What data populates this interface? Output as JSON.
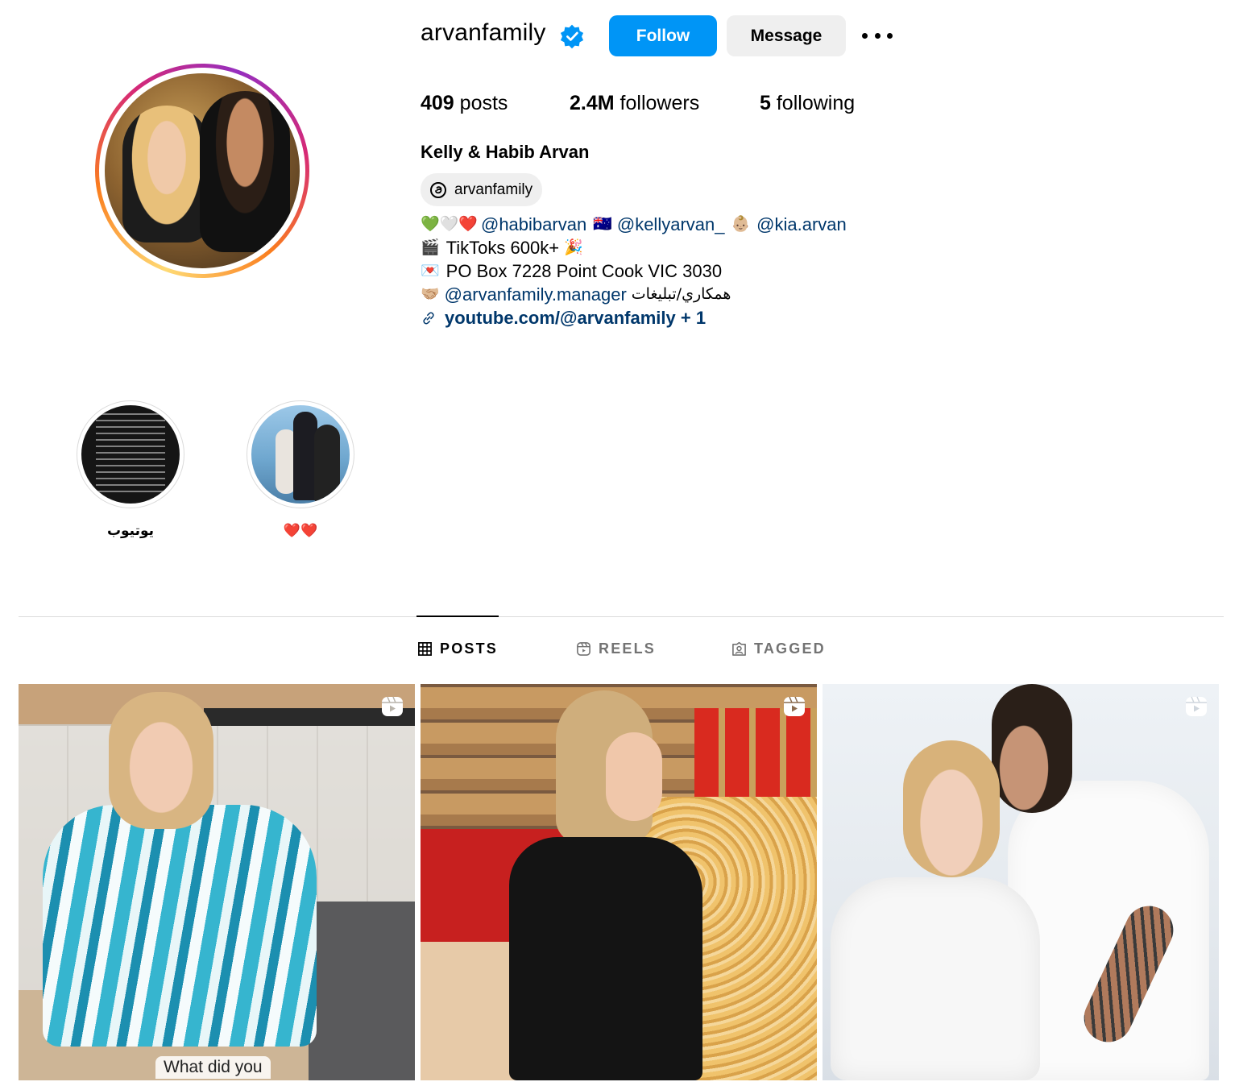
{
  "profile": {
    "username": "arvanfamily",
    "follow_label": "Follow",
    "message_label": "Message",
    "stats": {
      "posts_count": "409",
      "posts_label": "posts",
      "followers_count": "2.4M",
      "followers_label": "followers",
      "following_count": "5",
      "following_label": "following"
    },
    "full_name": "Kelly & Habib Arvan",
    "threads_handle": "arvanfamily",
    "bio": {
      "line1_emoji": "💚🤍❤️",
      "line1_mention1": "@habibarvan",
      "line1_flag": "🇦🇺",
      "line1_mention2": "@kellyarvan_",
      "line1_baby": "👶🏼",
      "line1_mention3": "@kia.arvan",
      "line2_emoji": "🎬",
      "line2_text": "TikToks 600k+",
      "line2_emoji_end": "🎉",
      "line3_emoji": "💌",
      "line3_text": "PO Box 7228 Point Cook VIC 3030",
      "line4_emoji": "🤝🏼",
      "line4_mention": "@arvanfamily.manager",
      "line4_text": "همكاري/تبليغات",
      "link_text": "youtube.com/@arvanfamily + 1"
    }
  },
  "highlights": [
    {
      "label": "يوتيوب"
    },
    {
      "label": "❤️❤️"
    }
  ],
  "tabs": [
    {
      "label": "POSTS",
      "icon": "grid-icon",
      "active": true
    },
    {
      "label": "REELS",
      "icon": "reels-icon",
      "active": false
    },
    {
      "label": "TAGGED",
      "icon": "tagged-icon",
      "active": false
    }
  ],
  "posts": [
    {
      "type": "reel",
      "caption": "What did you"
    },
    {
      "type": "reel"
    },
    {
      "type": "reel"
    }
  ],
  "colors": {
    "follow_button": "#0095f6",
    "message_button": "#efefef",
    "link": "#00376b",
    "verified": "#0095f6"
  }
}
